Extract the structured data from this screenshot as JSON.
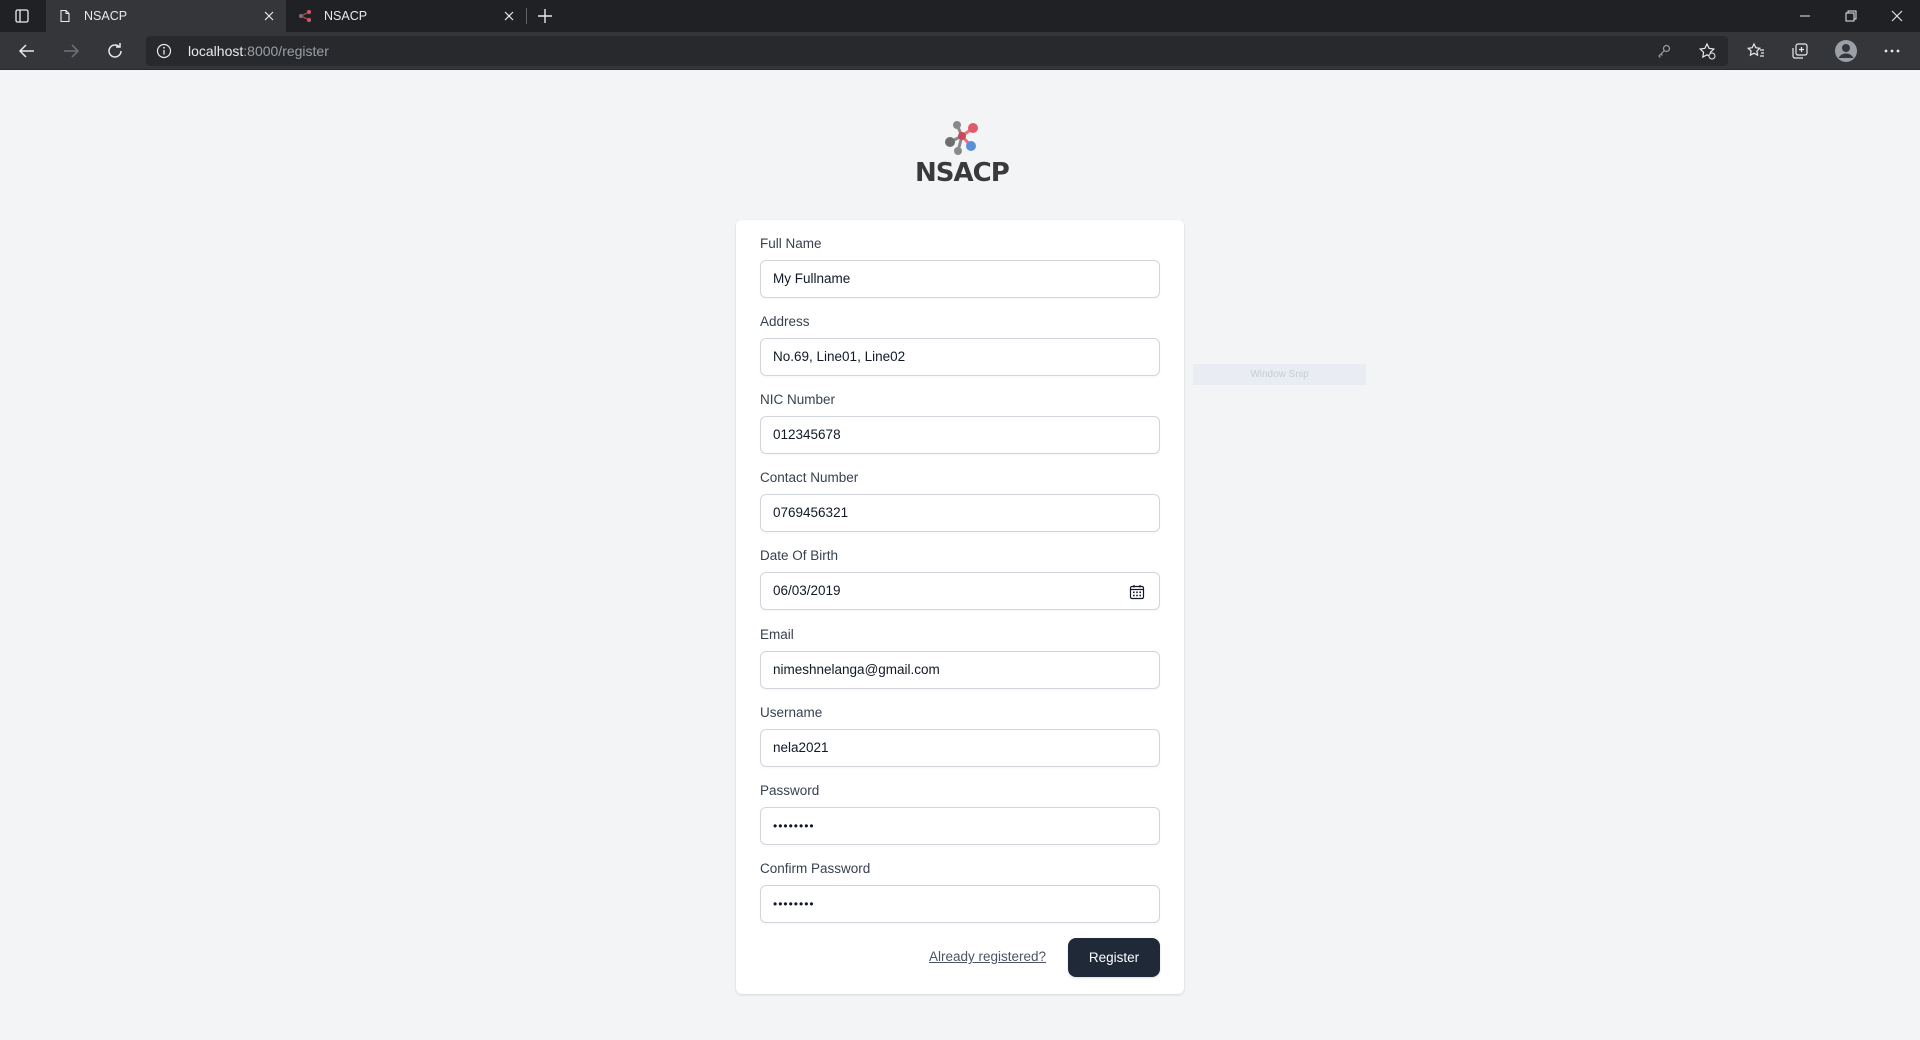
{
  "browser": {
    "tabs": [
      {
        "title": "NSACP",
        "active": true
      },
      {
        "title": "NSACP",
        "active": false
      }
    ],
    "url": {
      "host": "localhost",
      "path": ":8000/register"
    }
  },
  "logo": {
    "text": "NSACP"
  },
  "form": {
    "fields": [
      {
        "label": "Full Name",
        "value": "My Fullname"
      },
      {
        "label": "Address",
        "value": "No.69, Line01, Line02"
      },
      {
        "label": "NIC Number",
        "value": "012345678"
      },
      {
        "label": "Contact Number",
        "value": "0769456321"
      },
      {
        "label": "Date Of Birth",
        "value": "06/03/2019"
      },
      {
        "label": "Email",
        "value": "nimeshnelanga@gmail.com"
      },
      {
        "label": "Username",
        "value": "nela2021"
      },
      {
        "label": "Password",
        "value": "••••••••"
      },
      {
        "label": "Confirm Password",
        "value": "••••••••"
      }
    ],
    "already_registered": "Already registered?",
    "register_label": "Register"
  },
  "overlay": {
    "snip_label": "Window Snip"
  },
  "colors": {
    "primary_button": "#1f2937",
    "page_bg": "#f3f4f6",
    "tabbar": "#202124"
  }
}
